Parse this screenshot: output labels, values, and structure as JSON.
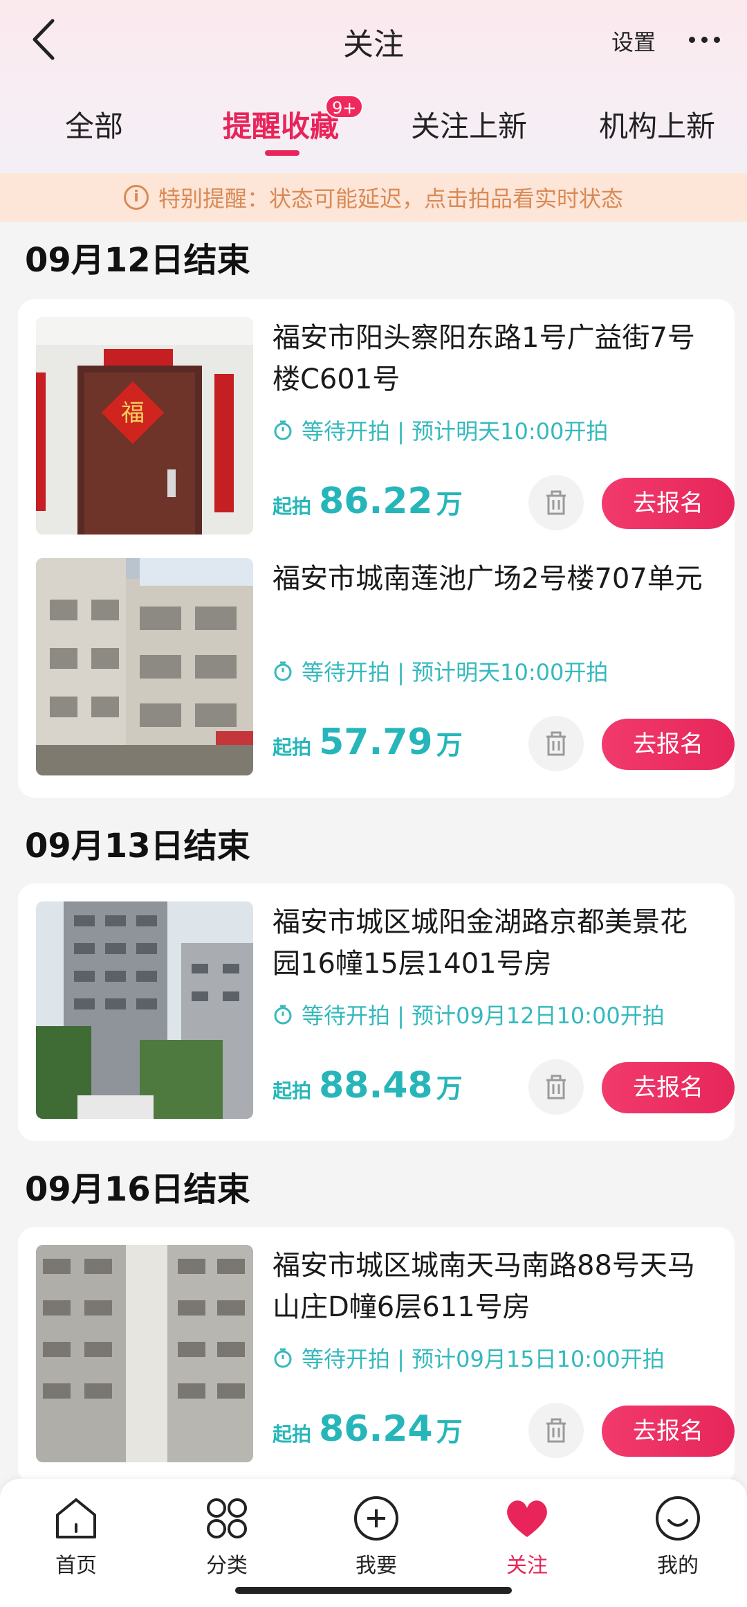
{
  "header": {
    "title": "关注",
    "settings_label": "设置"
  },
  "tabs": [
    {
      "label": "全部",
      "active": false
    },
    {
      "label": "提醒收藏",
      "active": true,
      "badge": "9+"
    },
    {
      "label": "关注上新",
      "active": false
    },
    {
      "label": "机构上新",
      "active": false
    }
  ],
  "notice": {
    "text": "特别提醒：状态可能延迟，点击拍品看实时状态",
    "icon": "info-icon"
  },
  "groups": [
    {
      "date_label": "09月12日结束",
      "items": [
        {
          "title": "福安市阳头察阳东路1号广益街7号楼C601号",
          "status": "等待开拍 | 预计明天10:00开拍",
          "price_prefix": "起拍",
          "price_value": "86.22",
          "price_unit": "万",
          "action_label": "去报名"
        },
        {
          "title": "福安市城南莲池广场2号楼707单元",
          "status": "等待开拍 | 预计明天10:00开拍",
          "price_prefix": "起拍",
          "price_value": "57.79",
          "price_unit": "万",
          "action_label": "去报名"
        }
      ]
    },
    {
      "date_label": "09月13日结束",
      "items": [
        {
          "title": "福安市城区城阳金湖路京都美景花园16幢15层1401号房",
          "status": "等待开拍 | 预计09月12日10:00开拍",
          "price_prefix": "起拍",
          "price_value": "88.48",
          "price_unit": "万",
          "action_label": "去报名"
        }
      ]
    },
    {
      "date_label": "09月16日结束",
      "items": [
        {
          "title": "福安市城区城南天马南路88号天马山庄D幢6层611号房",
          "status": "等待开拍 | 预计09月15日10:00开拍",
          "price_prefix": "起拍",
          "price_value": "86.24",
          "price_unit": "万",
          "action_label": "去报名"
        }
      ]
    }
  ],
  "bottom_nav": [
    {
      "label": "首页",
      "icon": "home-icon",
      "active": false
    },
    {
      "label": "分类",
      "icon": "category-icon",
      "active": false
    },
    {
      "label": "我要",
      "icon": "plus-circle-icon",
      "active": false
    },
    {
      "label": "关注",
      "icon": "heart-icon",
      "active": true
    },
    {
      "label": "我的",
      "icon": "smile-icon",
      "active": false
    }
  ],
  "colors": {
    "accent": "#e8245a",
    "price": "#26b6ba",
    "notice_text": "#d98a55",
    "notice_bg": "#fde5d8"
  }
}
